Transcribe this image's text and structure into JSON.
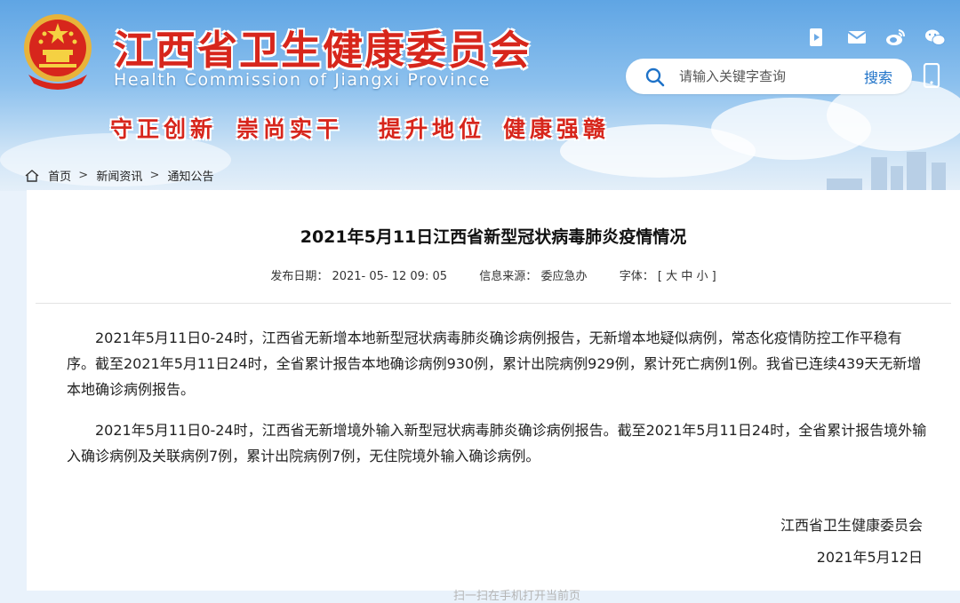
{
  "header": {
    "site_title": "江西省卫生健康委员会",
    "site_subtitle": "Health Commission of Jiangxi Province",
    "slogans": [
      "守正创新",
      "崇尚实干",
      "提升地位",
      "健康强赣"
    ],
    "search": {
      "placeholder": "请输入关键字查询",
      "button": "搜索"
    },
    "icons": [
      "app-icon",
      "mail-icon",
      "weibo-icon",
      "wechat-icon",
      "search-icon",
      "mobile-icon",
      "emblem-icon"
    ],
    "colors": {
      "title_red": "#d7261c",
      "sky_blue": "#5fa5e4",
      "link_blue": "#1e72c8"
    }
  },
  "breadcrumb": {
    "items": [
      "首页",
      "新闻资讯",
      "通知公告"
    ],
    "separator": ">"
  },
  "article": {
    "title": "2021年5月11日江西省新型冠状病毒肺炎疫情情况",
    "meta": {
      "date_label": "发布日期：",
      "date_value": "2021- 05- 12 09: 05",
      "source_label": "信息来源：",
      "source_value": "委应急办",
      "font_label": "字体：",
      "font_sizes": [
        "大",
        "中",
        "小"
      ]
    },
    "paragraphs": [
      "2021年5月11日0-24时，江西省无新增本地新型冠状病毒肺炎确诊病例报告，无新增本地疑似病例，常态化疫情防控工作平稳有序。截至2021年5月11日24时，全省累计报告本地确诊病例930例，累计出院病例929例，累计死亡病例1例。我省已连续439天无新增本地确诊病例报告。",
      "2021年5月11日0-24时，江西省无新增境外输入新型冠状病毒肺炎确诊病例报告。截至2021年5月11日24时，全省累计报告境外输入确诊病例及关联病例7例，累计出院病例7例，无住院境外输入确诊病例。"
    ],
    "signature": {
      "org": "江西省卫生健康委员会",
      "date": "2021年5月12日"
    },
    "footer_partial": "扫一扫在手机打开当前页"
  }
}
